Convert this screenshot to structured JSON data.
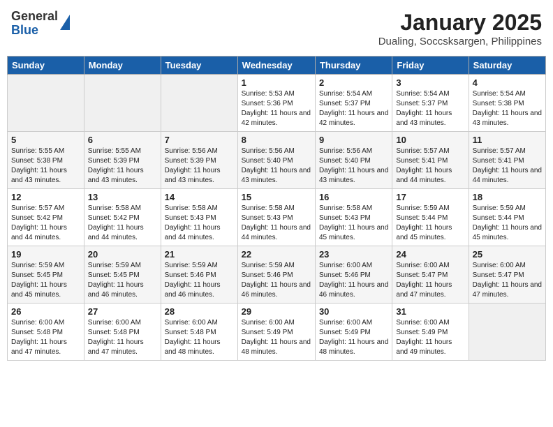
{
  "header": {
    "logo_general": "General",
    "logo_blue": "Blue",
    "month_title": "January 2025",
    "location": "Dualing, Soccsksargen, Philippines"
  },
  "weekdays": [
    "Sunday",
    "Monday",
    "Tuesday",
    "Wednesday",
    "Thursday",
    "Friday",
    "Saturday"
  ],
  "weeks": [
    [
      {
        "day": "",
        "sunrise": "",
        "sunset": "",
        "daylight": ""
      },
      {
        "day": "",
        "sunrise": "",
        "sunset": "",
        "daylight": ""
      },
      {
        "day": "",
        "sunrise": "",
        "sunset": "",
        "daylight": ""
      },
      {
        "day": "1",
        "sunrise": "Sunrise: 5:53 AM",
        "sunset": "Sunset: 5:36 PM",
        "daylight": "Daylight: 11 hours and 42 minutes."
      },
      {
        "day": "2",
        "sunrise": "Sunrise: 5:54 AM",
        "sunset": "Sunset: 5:37 PM",
        "daylight": "Daylight: 11 hours and 42 minutes."
      },
      {
        "day": "3",
        "sunrise": "Sunrise: 5:54 AM",
        "sunset": "Sunset: 5:37 PM",
        "daylight": "Daylight: 11 hours and 43 minutes."
      },
      {
        "day": "4",
        "sunrise": "Sunrise: 5:54 AM",
        "sunset": "Sunset: 5:38 PM",
        "daylight": "Daylight: 11 hours and 43 minutes."
      }
    ],
    [
      {
        "day": "5",
        "sunrise": "Sunrise: 5:55 AM",
        "sunset": "Sunset: 5:38 PM",
        "daylight": "Daylight: 11 hours and 43 minutes."
      },
      {
        "day": "6",
        "sunrise": "Sunrise: 5:55 AM",
        "sunset": "Sunset: 5:39 PM",
        "daylight": "Daylight: 11 hours and 43 minutes."
      },
      {
        "day": "7",
        "sunrise": "Sunrise: 5:56 AM",
        "sunset": "Sunset: 5:39 PM",
        "daylight": "Daylight: 11 hours and 43 minutes."
      },
      {
        "day": "8",
        "sunrise": "Sunrise: 5:56 AM",
        "sunset": "Sunset: 5:40 PM",
        "daylight": "Daylight: 11 hours and 43 minutes."
      },
      {
        "day": "9",
        "sunrise": "Sunrise: 5:56 AM",
        "sunset": "Sunset: 5:40 PM",
        "daylight": "Daylight: 11 hours and 43 minutes."
      },
      {
        "day": "10",
        "sunrise": "Sunrise: 5:57 AM",
        "sunset": "Sunset: 5:41 PM",
        "daylight": "Daylight: 11 hours and 44 minutes."
      },
      {
        "day": "11",
        "sunrise": "Sunrise: 5:57 AM",
        "sunset": "Sunset: 5:41 PM",
        "daylight": "Daylight: 11 hours and 44 minutes."
      }
    ],
    [
      {
        "day": "12",
        "sunrise": "Sunrise: 5:57 AM",
        "sunset": "Sunset: 5:42 PM",
        "daylight": "Daylight: 11 hours and 44 minutes."
      },
      {
        "day": "13",
        "sunrise": "Sunrise: 5:58 AM",
        "sunset": "Sunset: 5:42 PM",
        "daylight": "Daylight: 11 hours and 44 minutes."
      },
      {
        "day": "14",
        "sunrise": "Sunrise: 5:58 AM",
        "sunset": "Sunset: 5:43 PM",
        "daylight": "Daylight: 11 hours and 44 minutes."
      },
      {
        "day": "15",
        "sunrise": "Sunrise: 5:58 AM",
        "sunset": "Sunset: 5:43 PM",
        "daylight": "Daylight: 11 hours and 44 minutes."
      },
      {
        "day": "16",
        "sunrise": "Sunrise: 5:58 AM",
        "sunset": "Sunset: 5:43 PM",
        "daylight": "Daylight: 11 hours and 45 minutes."
      },
      {
        "day": "17",
        "sunrise": "Sunrise: 5:59 AM",
        "sunset": "Sunset: 5:44 PM",
        "daylight": "Daylight: 11 hours and 45 minutes."
      },
      {
        "day": "18",
        "sunrise": "Sunrise: 5:59 AM",
        "sunset": "Sunset: 5:44 PM",
        "daylight": "Daylight: 11 hours and 45 minutes."
      }
    ],
    [
      {
        "day": "19",
        "sunrise": "Sunrise: 5:59 AM",
        "sunset": "Sunset: 5:45 PM",
        "daylight": "Daylight: 11 hours and 45 minutes."
      },
      {
        "day": "20",
        "sunrise": "Sunrise: 5:59 AM",
        "sunset": "Sunset: 5:45 PM",
        "daylight": "Daylight: 11 hours and 46 minutes."
      },
      {
        "day": "21",
        "sunrise": "Sunrise: 5:59 AM",
        "sunset": "Sunset: 5:46 PM",
        "daylight": "Daylight: 11 hours and 46 minutes."
      },
      {
        "day": "22",
        "sunrise": "Sunrise: 5:59 AM",
        "sunset": "Sunset: 5:46 PM",
        "daylight": "Daylight: 11 hours and 46 minutes."
      },
      {
        "day": "23",
        "sunrise": "Sunrise: 6:00 AM",
        "sunset": "Sunset: 5:46 PM",
        "daylight": "Daylight: 11 hours and 46 minutes."
      },
      {
        "day": "24",
        "sunrise": "Sunrise: 6:00 AM",
        "sunset": "Sunset: 5:47 PM",
        "daylight": "Daylight: 11 hours and 47 minutes."
      },
      {
        "day": "25",
        "sunrise": "Sunrise: 6:00 AM",
        "sunset": "Sunset: 5:47 PM",
        "daylight": "Daylight: 11 hours and 47 minutes."
      }
    ],
    [
      {
        "day": "26",
        "sunrise": "Sunrise: 6:00 AM",
        "sunset": "Sunset: 5:48 PM",
        "daylight": "Daylight: 11 hours and 47 minutes."
      },
      {
        "day": "27",
        "sunrise": "Sunrise: 6:00 AM",
        "sunset": "Sunset: 5:48 PM",
        "daylight": "Daylight: 11 hours and 47 minutes."
      },
      {
        "day": "28",
        "sunrise": "Sunrise: 6:00 AM",
        "sunset": "Sunset: 5:48 PM",
        "daylight": "Daylight: 11 hours and 48 minutes."
      },
      {
        "day": "29",
        "sunrise": "Sunrise: 6:00 AM",
        "sunset": "Sunset: 5:49 PM",
        "daylight": "Daylight: 11 hours and 48 minutes."
      },
      {
        "day": "30",
        "sunrise": "Sunrise: 6:00 AM",
        "sunset": "Sunset: 5:49 PM",
        "daylight": "Daylight: 11 hours and 48 minutes."
      },
      {
        "day": "31",
        "sunrise": "Sunrise: 6:00 AM",
        "sunset": "Sunset: 5:49 PM",
        "daylight": "Daylight: 11 hours and 49 minutes."
      },
      {
        "day": "",
        "sunrise": "",
        "sunset": "",
        "daylight": ""
      }
    ]
  ]
}
